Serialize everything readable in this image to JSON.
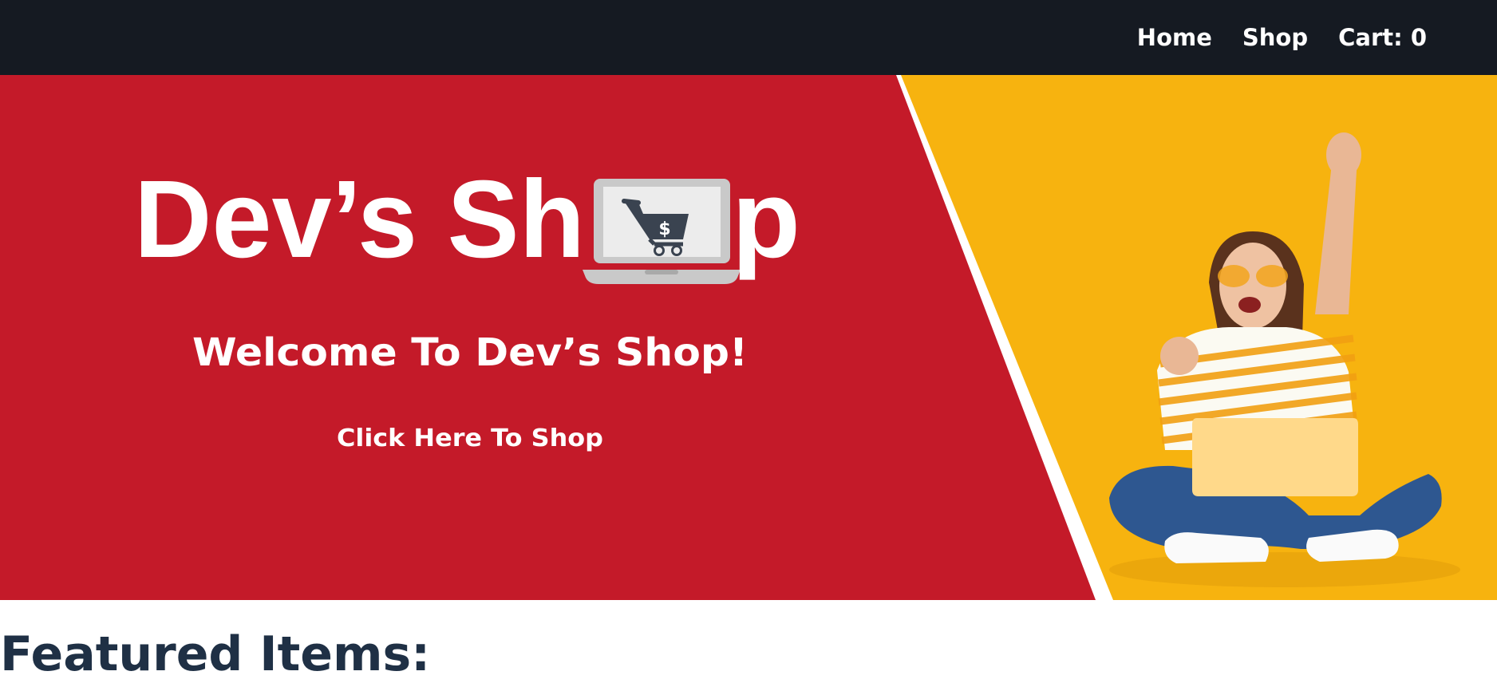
{
  "nav": {
    "home_label": "Home",
    "shop_label": "Shop",
    "cart_label": "Cart: 0"
  },
  "hero": {
    "brand_prefix": "Dev’s Sh",
    "brand_suffix": "p",
    "currency_symbol": "$",
    "welcome_text": "Welcome To Dev’s Shop!",
    "cta_label": "Click Here To Shop",
    "colors": {
      "left_panel": "#c41a29",
      "right_panel": "#f7b30f",
      "divider": "#ffffff"
    }
  },
  "main": {
    "featured_title": "Featured Items:"
  }
}
